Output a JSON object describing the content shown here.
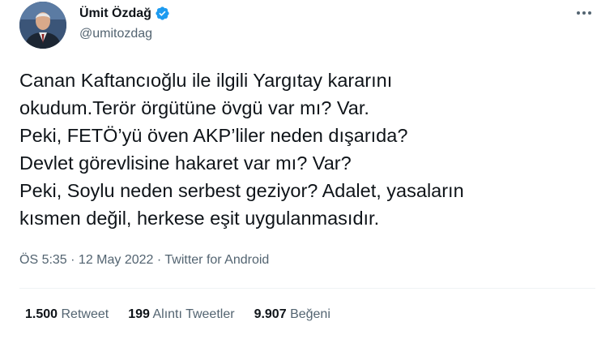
{
  "author": {
    "name": "Ümit Özdağ",
    "handle": "@umitozdag",
    "verified": true
  },
  "tweet": {
    "lines": [
      "Canan Kaftancıoğlu ile ilgili Yargıtay kararını",
      "okudum.Terör örgütüne övgü var mı? Var.",
      "Peki, FETÖ’yü öven AKP’liler neden dışarıda?",
      "Devlet görevlisine hakaret var mı? Var?",
      "Peki, Soylu neden serbest geziyor? Adalet, yasaların",
      "kısmen değil, herkese eşit uygulanmasıdır."
    ]
  },
  "meta": {
    "time": "ÖS 5:35",
    "separator1": " · ",
    "date": "12 May 2022",
    "separator2": " · ",
    "source": "Twitter for Android"
  },
  "stats": [
    {
      "count": "1.500",
      "label": "Retweet"
    },
    {
      "count": "199",
      "label": "Alıntı Tweetler"
    },
    {
      "count": "9.907",
      "label": "Beğeni"
    }
  ],
  "colors": {
    "text": "#0f1419",
    "secondary": "#536471",
    "verified": "#1d9bf0",
    "divider": "#eff3f4"
  },
  "icons": {
    "more": "more-horizontal-icon",
    "verified": "verified-badge-icon"
  }
}
